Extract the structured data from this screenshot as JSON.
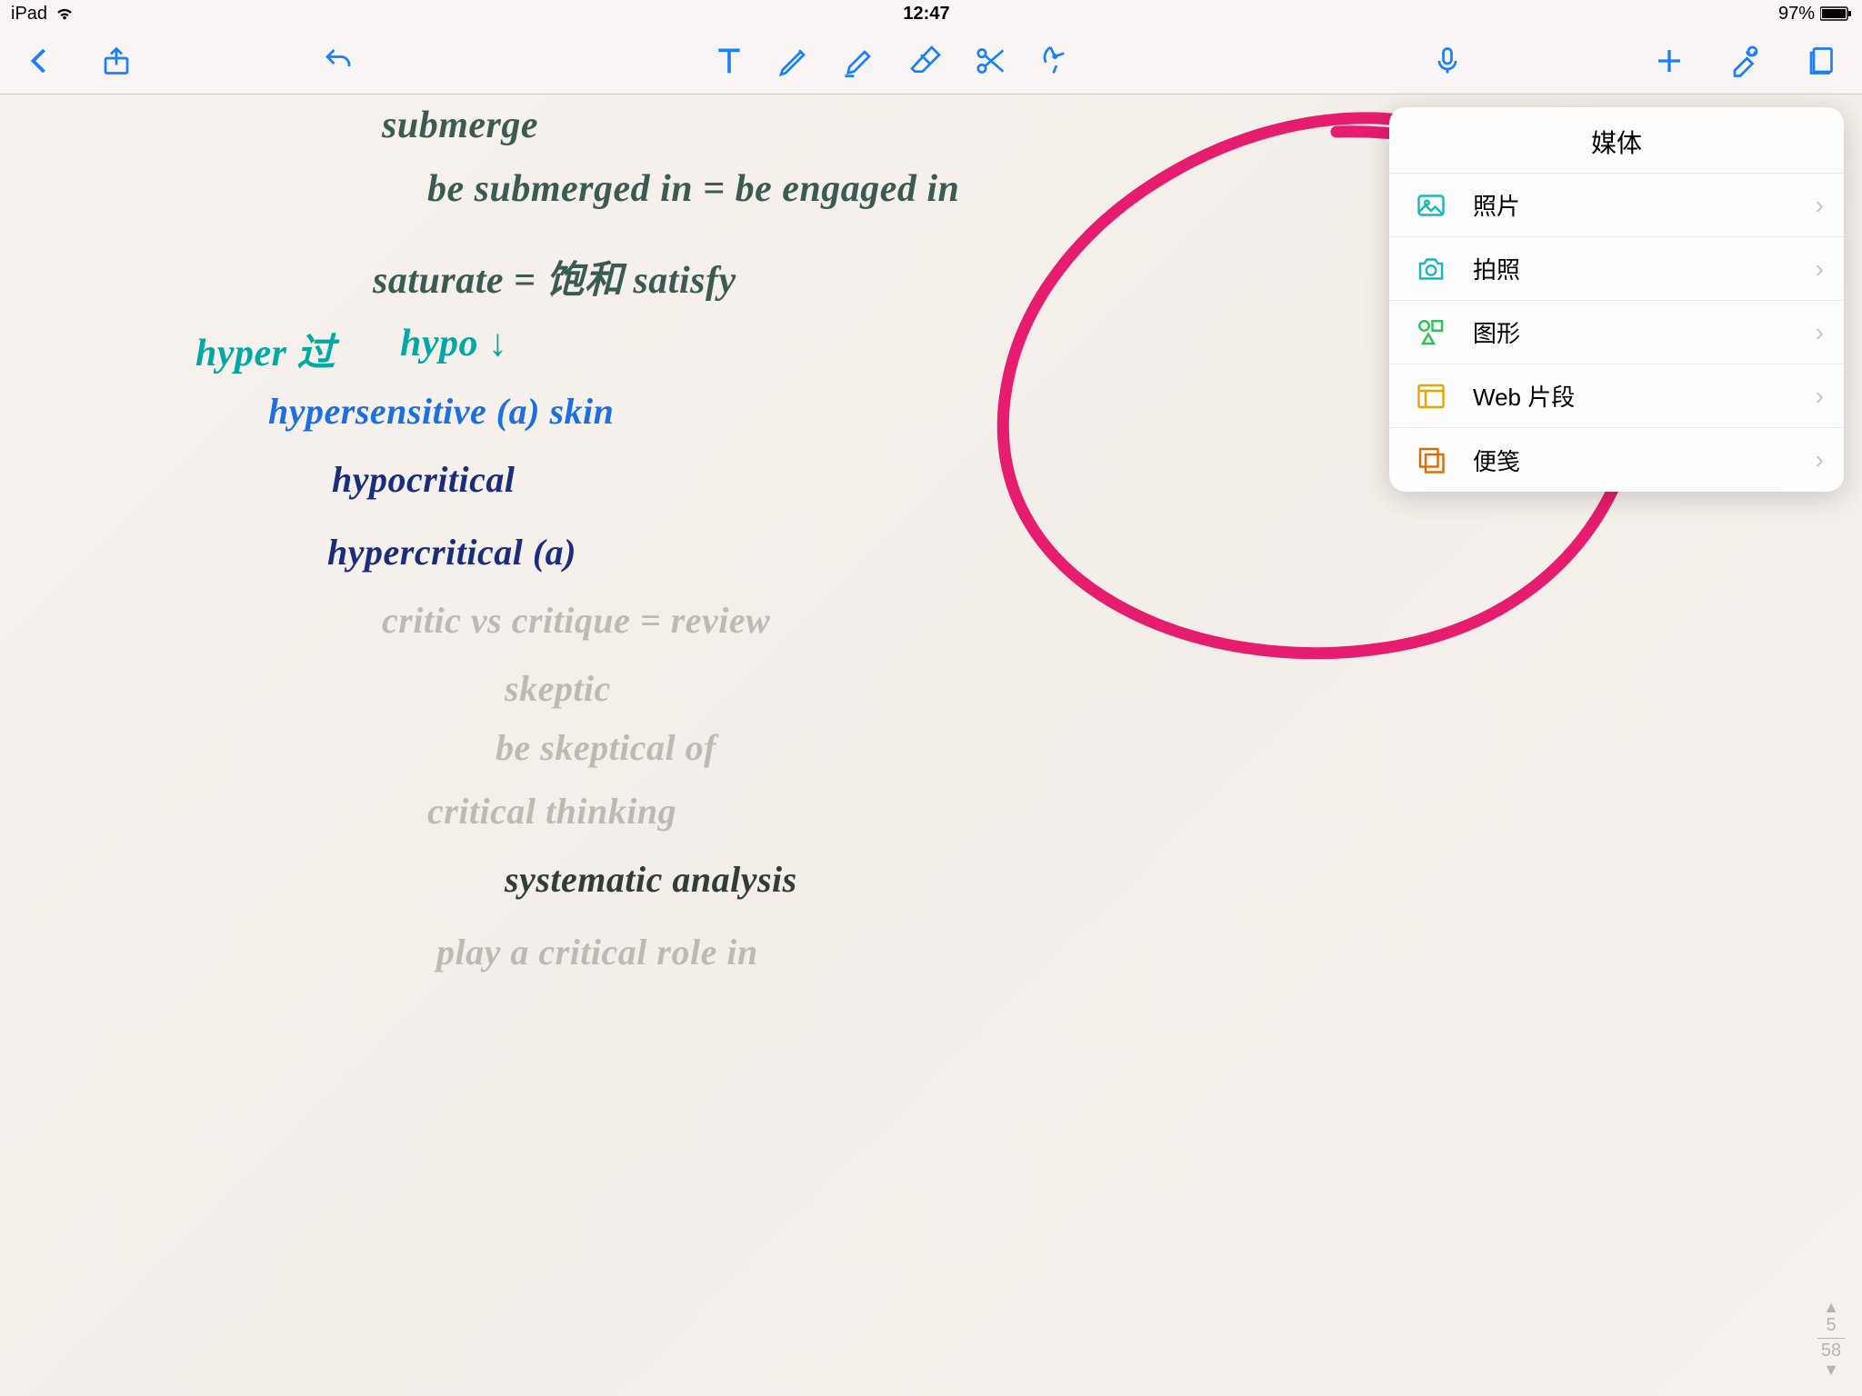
{
  "status": {
    "device": "iPad",
    "time": "12:47",
    "battery": "97%"
  },
  "popover": {
    "title": "媒体",
    "items": [
      {
        "label": "照片",
        "icon": "photo-icon",
        "color": "#16b6c2"
      },
      {
        "label": "拍照",
        "icon": "camera-icon",
        "color": "#16b6c2"
      },
      {
        "label": "图形",
        "icon": "shape-icon",
        "color": "#2fbf54"
      },
      {
        "label": "Web 片段",
        "icon": "webclip-icon",
        "color": "#e6a500"
      },
      {
        "label": "便笺",
        "icon": "sticky-icon",
        "color": "#e06a00"
      }
    ]
  },
  "page": {
    "current": "5",
    "total": "58"
  },
  "notes": {
    "l1": "submerge",
    "l2": "be submerged in = be engaged in",
    "l3": "saturate = 饱和  satisfy",
    "l4a": "hyper 过",
    "l4b": "hypo ↓",
    "l5": "hypersensitive (a)  skin",
    "l6": "hypocritical",
    "l7": "hypercritical (a)",
    "l8": "critic  vs critique = review",
    "l9": "skeptic",
    "l10": "be skeptical  of",
    "l11": "critical  thinking",
    "l12": "systematic  analysis",
    "l13": "play a critical  role in"
  }
}
